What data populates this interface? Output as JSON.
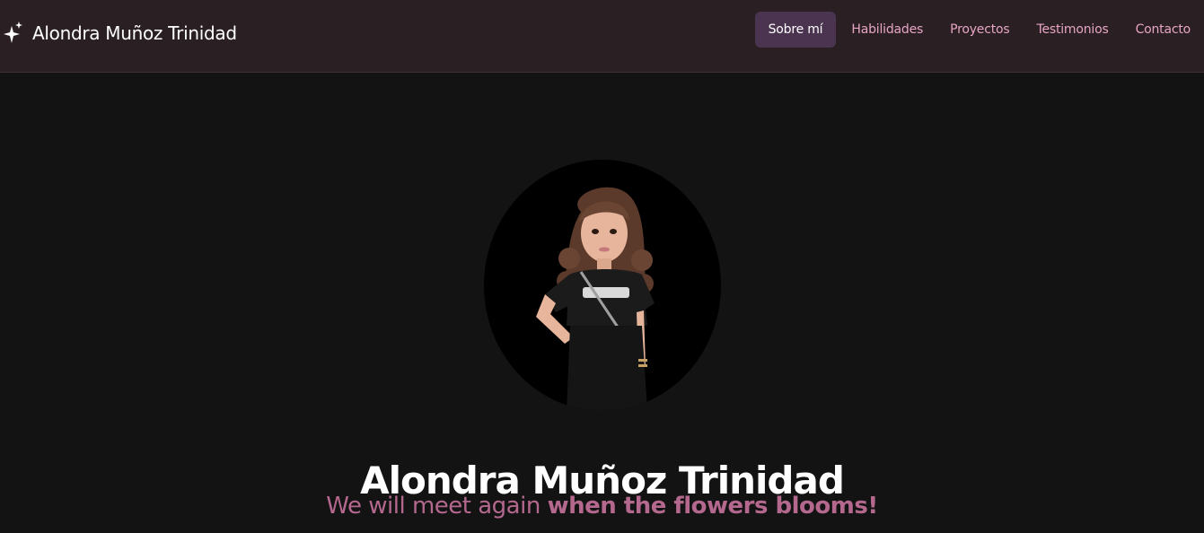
{
  "brand": {
    "icon": "sparkles-icon",
    "name": "Alondra Muñoz Trinidad"
  },
  "nav": {
    "items": [
      {
        "label": "Sobre mí",
        "active": true
      },
      {
        "label": "Habilidades",
        "active": false
      },
      {
        "label": "Proyectos",
        "active": false
      },
      {
        "label": "Testimonios",
        "active": false
      },
      {
        "label": "Contacto",
        "active": false
      }
    ]
  },
  "hero": {
    "name": "Alondra Muñoz Trinidad",
    "tagline_regular": "We will meet again ",
    "tagline_bold": "when the flowers blooms!"
  },
  "colors": {
    "navbar_bg": "#2a2023",
    "page_bg": "#131313",
    "nav_link": "#e7a5c3",
    "nav_active_bg": "#4a3450",
    "tagline": "#b4688e"
  }
}
